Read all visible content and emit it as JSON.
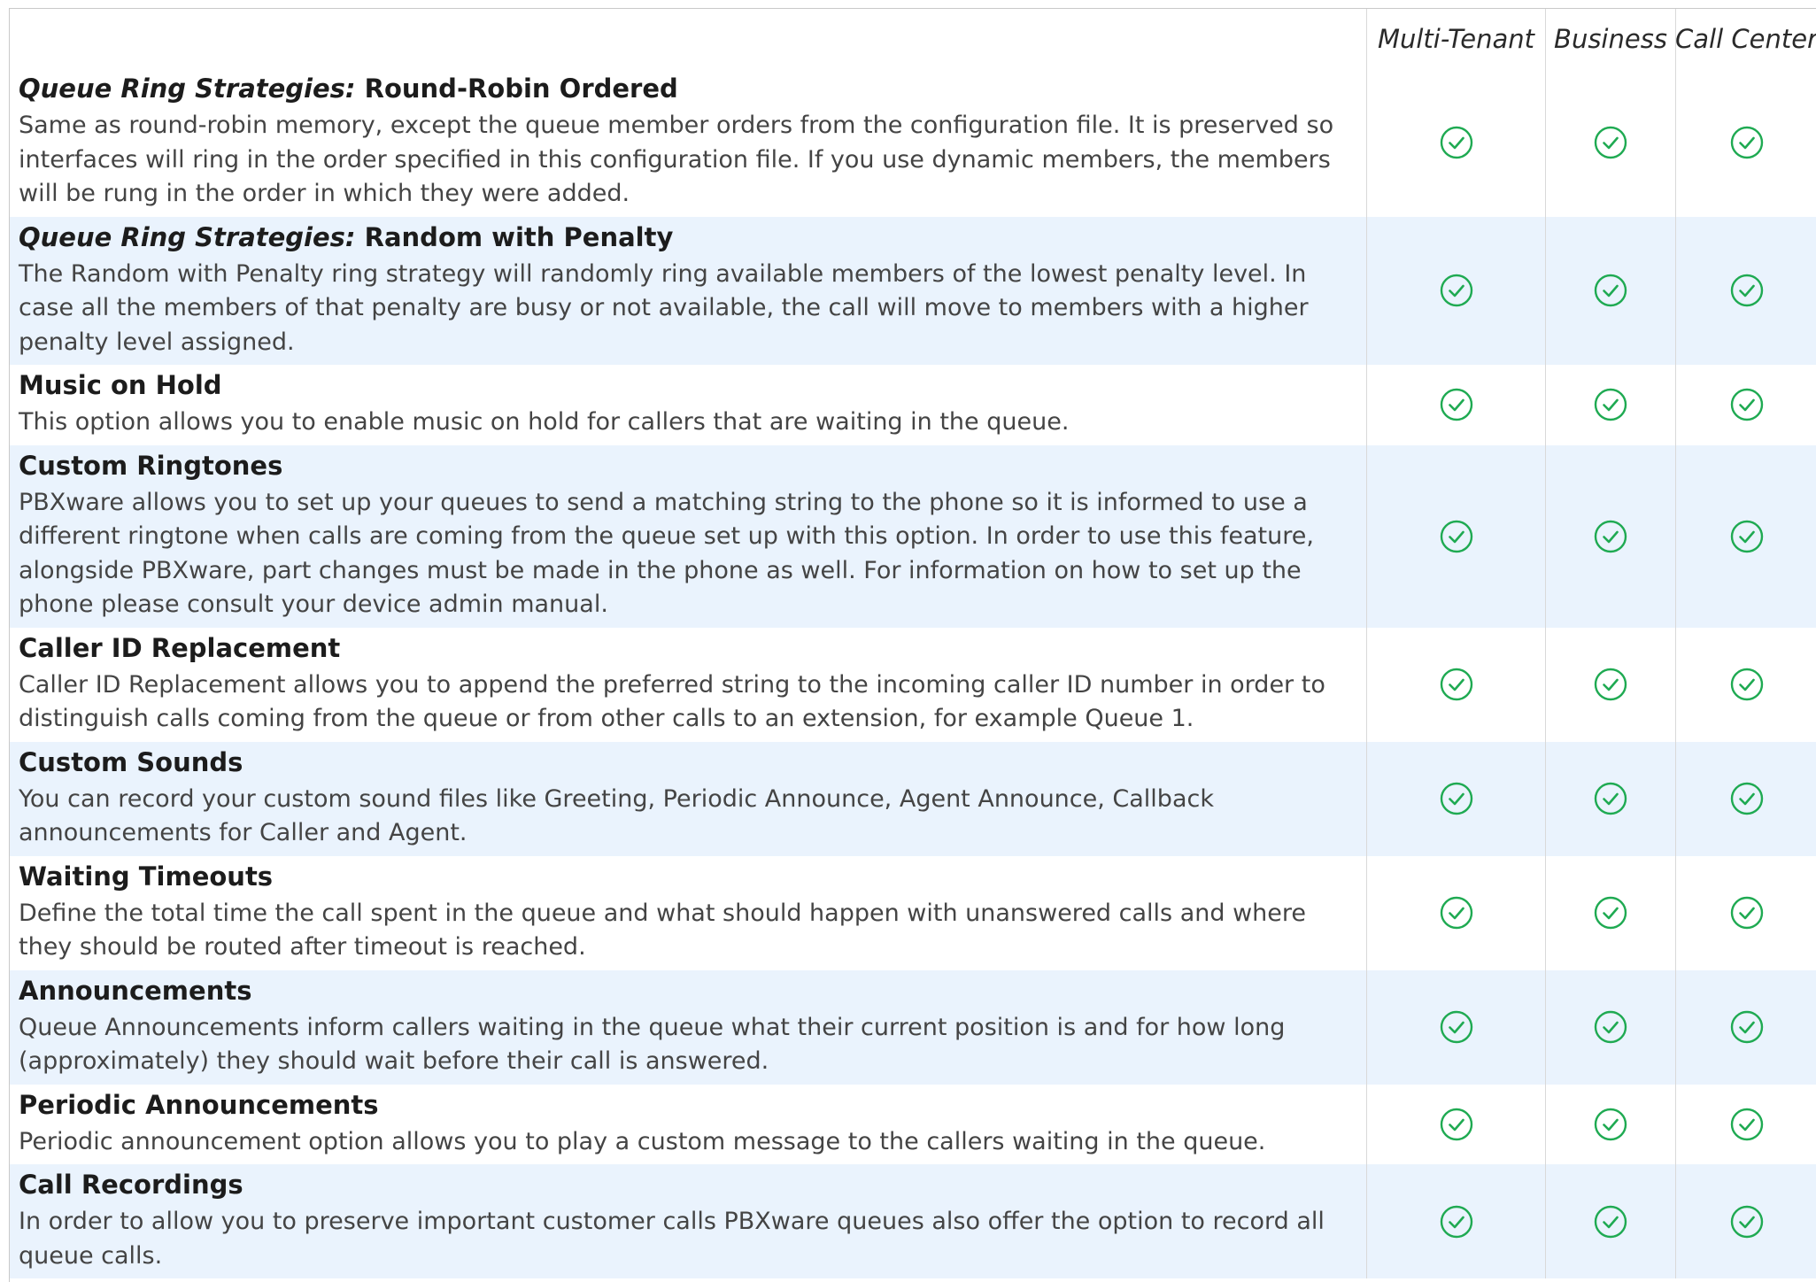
{
  "columns": [
    "Multi-Tenant",
    "Business",
    "Call Center"
  ],
  "accent_color": "#1faa52",
  "shade_color": "#eaf3fd",
  "check_icon": "circle-check-icon",
  "rows": [
    {
      "prefix": "Queue Ring Strategies:",
      "title": "Round-Robin Ordered",
      "desc": "Same as round-robin memory, except the queue member orders from the configuration file. It is preserved so interfaces will ring in the order specified in this configuration file. If you use dynamic members, the members will be rung in the order in which they were added.",
      "lines": 3
    },
    {
      "prefix": "Queue Ring Strategies:",
      "title": "Random with Penalty",
      "desc": "The Random with Penalty ring strategy will randomly ring available members of the lowest penalty level. In case all the members of that penalty are busy or not available, the call will move to members with a higher penalty level assigned.",
      "lines": 3
    },
    {
      "prefix": "",
      "title": "Music on Hold",
      "desc": "This option allows you to enable music on hold for callers that are waiting in the queue.",
      "lines": 1
    },
    {
      "prefix": "",
      "title": "Custom Ringtones",
      "desc": "PBXware allows you to set up your queues to send a matching string to the phone so it is informed to use a different ringtone when calls are coming from the queue set up with this option. In order to use this feature, alongside PBXware, part changes must be made in the phone as well. For information on how to set up the phone please consult your device admin manual.",
      "lines": 4
    },
    {
      "prefix": "",
      "title": "Caller ID Replacement",
      "desc": "Caller ID Replacement allows you to append the preferred string to the incoming caller ID number in order to distinguish calls coming from the queue or from other calls to an extension, for example Queue 1.",
      "lines": 2
    },
    {
      "prefix": "",
      "title": "Custom Sounds",
      "desc": "You can record your custom sound files like Greeting, Periodic Announce, Agent Announce, Callback announcements for Caller and Agent.",
      "lines": 2
    },
    {
      "prefix": "",
      "title": "Waiting Timeouts",
      "desc": "Define the total time the call spent in the queue and what should happen with unanswered calls and where they should be routed after timeout is reached.",
      "lines": 2
    },
    {
      "prefix": "",
      "title": "Announcements",
      "desc": "Queue Announcements inform callers waiting in the queue what their current position is and for how long (approximately) they should wait before their call is answered.",
      "lines": 2
    },
    {
      "prefix": "",
      "title": "Periodic Announcements",
      "desc": "Periodic announcement option allows you to play a custom message to the callers waiting in the queue.",
      "lines": 1
    },
    {
      "prefix": "",
      "title": "Call Recordings",
      "desc": "In order to allow you to preserve important customer calls PBXware queues also offer the option to record all queue calls.",
      "lines": 2
    }
  ]
}
